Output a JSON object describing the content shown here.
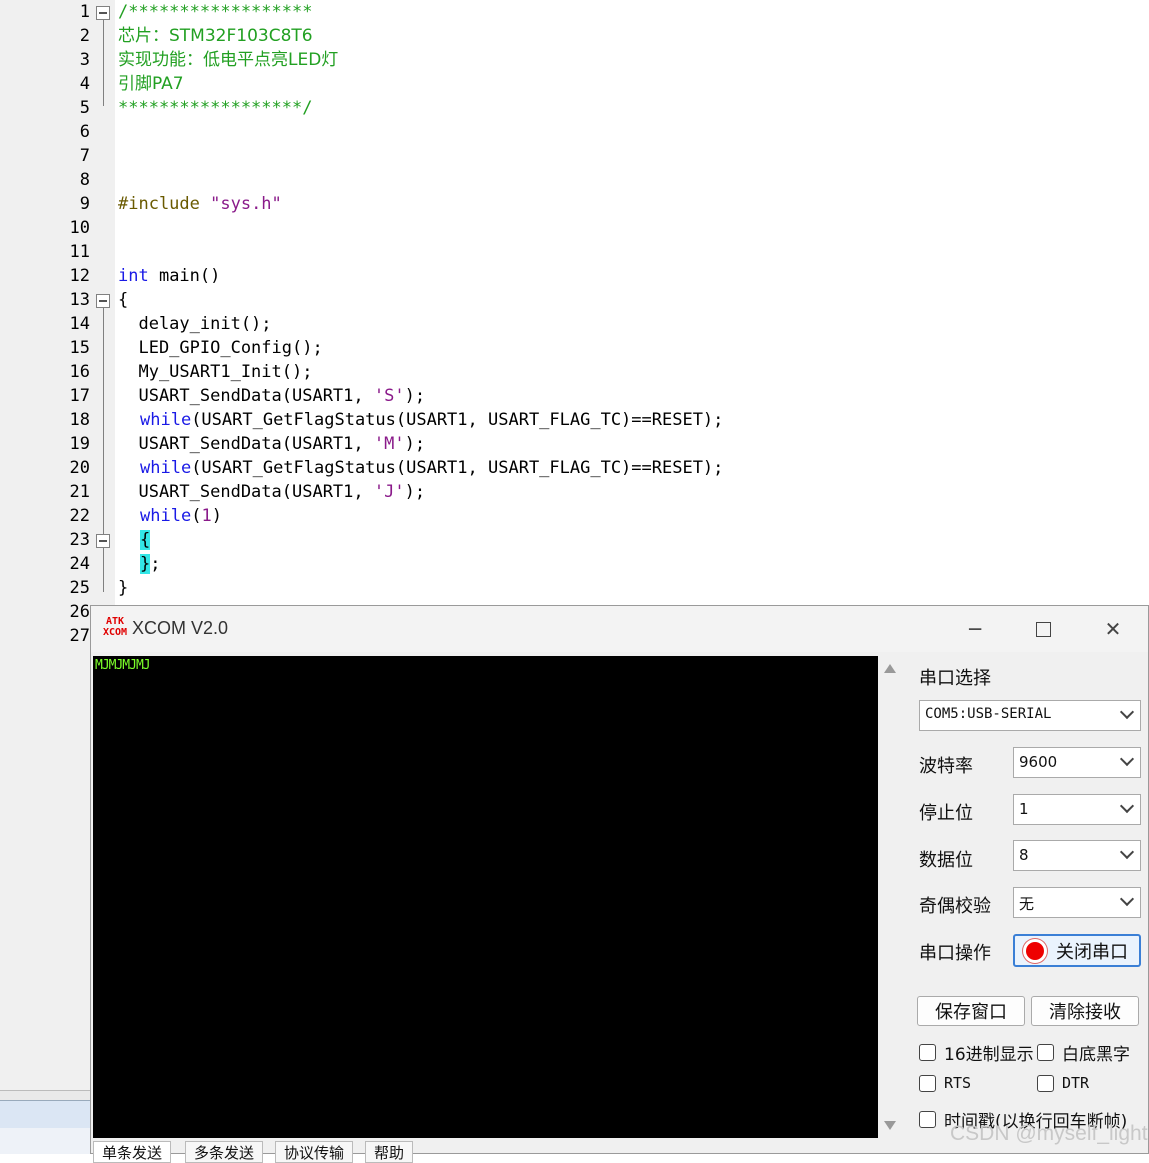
{
  "editor": {
    "line_numbers": [
      "1",
      "2",
      "3",
      "4",
      "5",
      "6",
      "7",
      "8",
      "9",
      "10",
      "11",
      "12",
      "13",
      "14",
      "15",
      "16",
      "17",
      "18",
      "19",
      "20",
      "21",
      "22",
      "23",
      "24",
      "25",
      "26",
      "27"
    ],
    "lines": {
      "l1": "/******************",
      "l2": "芯片：STM32F103C8T6",
      "l3": "实现功能：低电平点亮LED灯",
      "l4": "引脚PA7",
      "l5": "******************/",
      "l9a": "#include ",
      "l9b": "\"sys.h\"",
      "l12a": "int",
      "l12b": " main()",
      "l13": "{",
      "l14": "  delay_init();",
      "l15": "  LED_GPIO_Config();",
      "l16": "  My_USART1_Init();",
      "l17a": "  USART_SendData(USART1, ",
      "l17b": "'S'",
      "l17c": ");",
      "l18a": "while",
      "l18b": "(USART_GetFlagStatus(USART1, USART_FLAG_TC)==RESET);",
      "l19a": "  USART_SendData(USART1, ",
      "l19b": "'M'",
      "l19c": ");",
      "l20a": "while",
      "l20b": "(USART_GetFlagStatus(USART1, USART_FLAG_TC)==RESET);",
      "l21a": "  USART_SendData(USART1, ",
      "l21b": "'J'",
      "l21c": ");",
      "l22a": "while",
      "l22b": "(",
      "l22c": "1",
      "l22d": ")",
      "l23": "{",
      "l24a": "}",
      "l24b": ";",
      "l25": "}"
    }
  },
  "xcom": {
    "logo_top": "ATK",
    "logo_bottom": "XCOM",
    "title": "XCOM V2.0",
    "received": "MJMJMJMJ",
    "labels": {
      "port_select": "串口选择",
      "baud": "波特率",
      "stop_bits": "停止位",
      "data_bits": "数据位",
      "parity": "奇偶校验",
      "port_op": "串口操作"
    },
    "values": {
      "port": "COM5:USB-SERIAL",
      "baud": "9600",
      "stop_bits": "1",
      "data_bits": "8",
      "parity": "无"
    },
    "buttons": {
      "close_port": "关闭串口",
      "save_window": "保存窗口",
      "clear_rx": "清除接收"
    },
    "checkboxes": {
      "hex_display": "16进制显示",
      "white_bg": "白底黑字",
      "rts": "RTS",
      "dtr": "DTR",
      "timestamp": "时间戳(以换行回车断帧)"
    },
    "tabs": [
      "单条发送",
      "多条发送",
      "协议传输",
      "帮助"
    ]
  },
  "watermark": "CSDN @myself_light"
}
